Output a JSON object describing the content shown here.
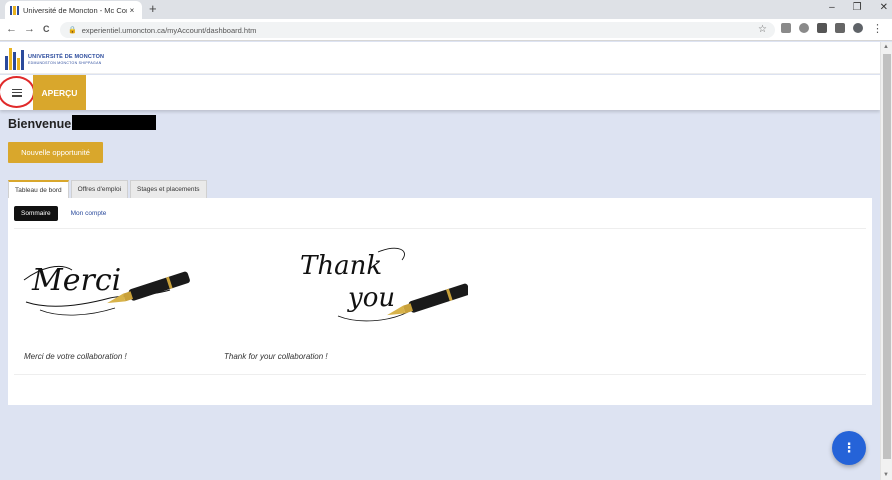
{
  "browser": {
    "tab_title": "Université de Moncton - Mc Con",
    "tab_close": "×",
    "new_tab": "+",
    "window_controls": [
      "–",
      "❐",
      "✕"
    ],
    "back": "←",
    "forward": "→",
    "reload": "C",
    "url": "experientiel.umoncton.ca/myAccount/dashboard.htm",
    "star": "☆",
    "menu": "⋮"
  },
  "header": {
    "logo_line1": "UNIVERSITÉ DE MONCTON",
    "logo_line2": "EDMUNDSTON  MONCTON  SHIPPAGAN",
    "menu_icon": "hamburger-menu",
    "apercu_label": "APERÇU"
  },
  "main": {
    "welcome": "Bienvenue",
    "new_opportunity": "Nouvelle opportunité",
    "tabs": [
      {
        "label": "Tableau de bord",
        "active": true
      },
      {
        "label": "Offres d'emploi",
        "active": false
      },
      {
        "label": "Stages et placements",
        "active": false
      }
    ],
    "subtabs": [
      {
        "label": "Sommaire",
        "active": true
      },
      {
        "label": "Mon compte",
        "active": false
      }
    ],
    "merci_script": "Merci",
    "thankyou_script1": "Thank",
    "thankyou_script2": "you",
    "caption_fr": "Merci de votre collaboration !",
    "caption_en": "Thank for your collaboration !"
  },
  "fab": {
    "icon": "⋮"
  },
  "colors": {
    "accent": "#d9a72c",
    "brand_blue": "#2a4a9c",
    "fab": "#2563d8",
    "page_bg": "#dde3f2"
  }
}
